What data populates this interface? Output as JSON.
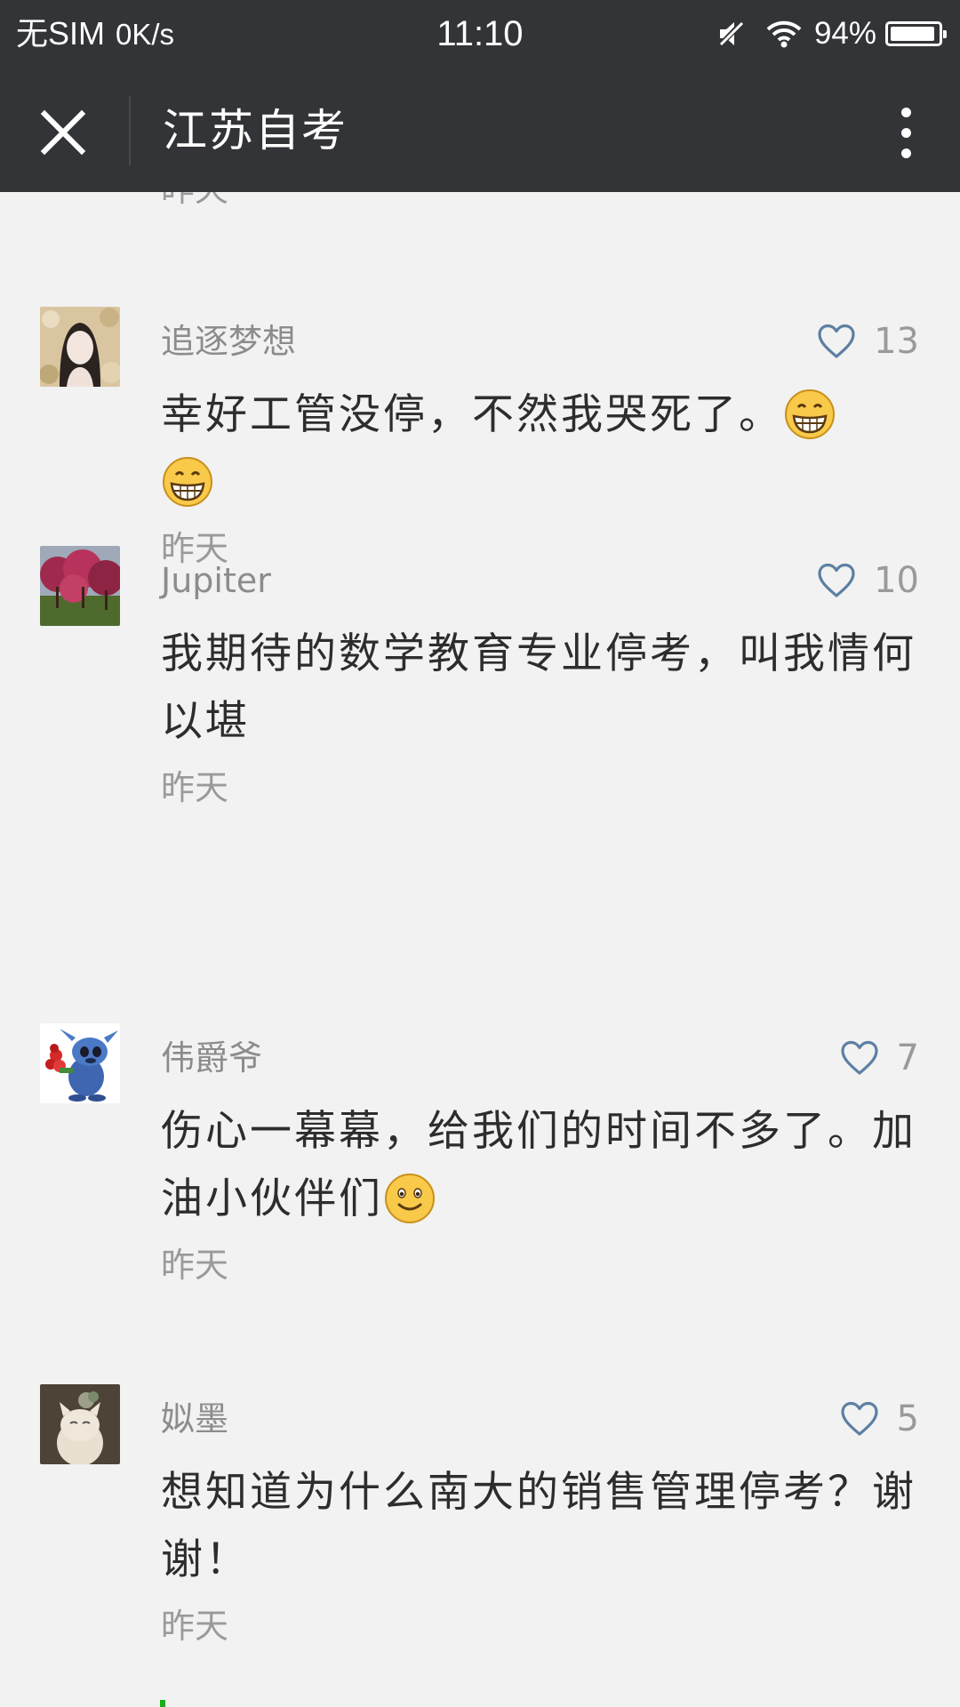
{
  "status_bar": {
    "carrier": "无SIM",
    "speed": "0K/s",
    "time": "11:10",
    "battery_percent": "94%",
    "battery_level": 0.94
  },
  "nav": {
    "title": "江苏自考"
  },
  "previous_comment_time": "昨天",
  "comments": [
    {
      "name": "追逐梦想",
      "likes": "13",
      "text_parts": [
        "幸好工管没停，不然我哭死了。",
        "grin-emoji",
        "grin-emoji"
      ],
      "time": "昨天"
    },
    {
      "name": "Jupiter",
      "likes": "10",
      "text": "我期待的数学教育专业停考，叫我情何以堪",
      "time": "昨天"
    },
    {
      "name": "伟爵爷",
      "likes": "7",
      "text_parts": [
        "伤心一幕幕，给我们的时间不多了。加油小伙伴们",
        "smile-emoji"
      ],
      "time": "昨天"
    },
    {
      "name": "姒墨",
      "likes": "5",
      "text": "想知道为什么南大的销售管理停考？谢谢！",
      "time": "昨天"
    }
  ],
  "colors": {
    "bar_bg": "#333437",
    "page_bg": "#f2f2f2",
    "like_icon": "#5d7fa3",
    "accent_green": "#1aad19"
  }
}
